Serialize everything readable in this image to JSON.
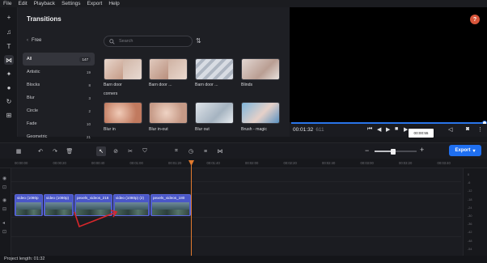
{
  "menu": [
    "File",
    "Edit",
    "Playback",
    "Settings",
    "Export",
    "Help"
  ],
  "sidebar_icons": [
    "plus-icon",
    "music-icon",
    "text-icon",
    "transitions-icon",
    "effects-icon",
    "stickers-icon",
    "rotate-icon",
    "templates-icon"
  ],
  "panel": {
    "title": "Transitions",
    "free_label": "Free",
    "search_placeholder": "Search",
    "categories": [
      {
        "label": "All",
        "count": "147",
        "active": true
      },
      {
        "label": "Artistic",
        "count": "19"
      },
      {
        "label": "Blocks",
        "count": "8"
      },
      {
        "label": "Blur",
        "count": "3"
      },
      {
        "label": "Circle",
        "count": "2"
      },
      {
        "label": "Fade",
        "count": "10"
      },
      {
        "label": "Geometric",
        "count": "21"
      }
    ],
    "thumbnails": [
      {
        "label": "Barn door",
        "bg": "#d9c3b5"
      },
      {
        "label": "Barn door ...",
        "bg": "#d8c0b4"
      },
      {
        "label": "Barn door ...",
        "bg": "#c9cdd5"
      },
      {
        "label": "Blinds",
        "bg": "#d4c7c2"
      },
      {
        "label": "Blur in",
        "bg": "#c68a72"
      },
      {
        "label": "Blur in-out",
        "bg": "#c9a08e"
      },
      {
        "label": "Blur out",
        "bg": "#b9c3cc"
      },
      {
        "label": "Brush - magic",
        "bg": "#6fa4c9"
      }
    ],
    "corners_label": "corners"
  },
  "preview": {
    "help": "?",
    "time": "00:01:32",
    "frames": "611",
    "tooltip": "00:00:55",
    "progress": 1.0
  },
  "timeline": {
    "zoom_level": 0.45,
    "export_label": "Export",
    "ruler": [
      "00:00:00",
      "00:00:20",
      "00:00:40",
      "00:01:00",
      "00:01:20",
      "00:01:40",
      "00:02:00",
      "00:02:20",
      "00:02:40",
      "00:03:00",
      "00:03:20",
      "00:03:40"
    ],
    "clips": [
      {
        "label": "video (1080p",
        "start": 18,
        "end": 53
      },
      {
        "label": "video (1080p)",
        "start": 54,
        "end": 91
      },
      {
        "label": "pexels_videos_216",
        "start": 92,
        "end": 139
      },
      {
        "label": "video (1080p) (2)",
        "start": 140,
        "end": 185
      },
      {
        "label": "pexels_videos_180",
        "start": 186,
        "end": 236
      }
    ],
    "meter_labels": [
      "0",
      "-6",
      "-12",
      "-18",
      "-24",
      "-30",
      "-36",
      "-42",
      "-48",
      "-54"
    ]
  },
  "status": {
    "project_length": "Project length: 01:32"
  },
  "colors": {
    "accent": "#1f6ff0",
    "playhead": "#e07a2e",
    "clip": "#4a57c8",
    "annotation_arrow": "#d9272b",
    "help": "#d8563b"
  }
}
